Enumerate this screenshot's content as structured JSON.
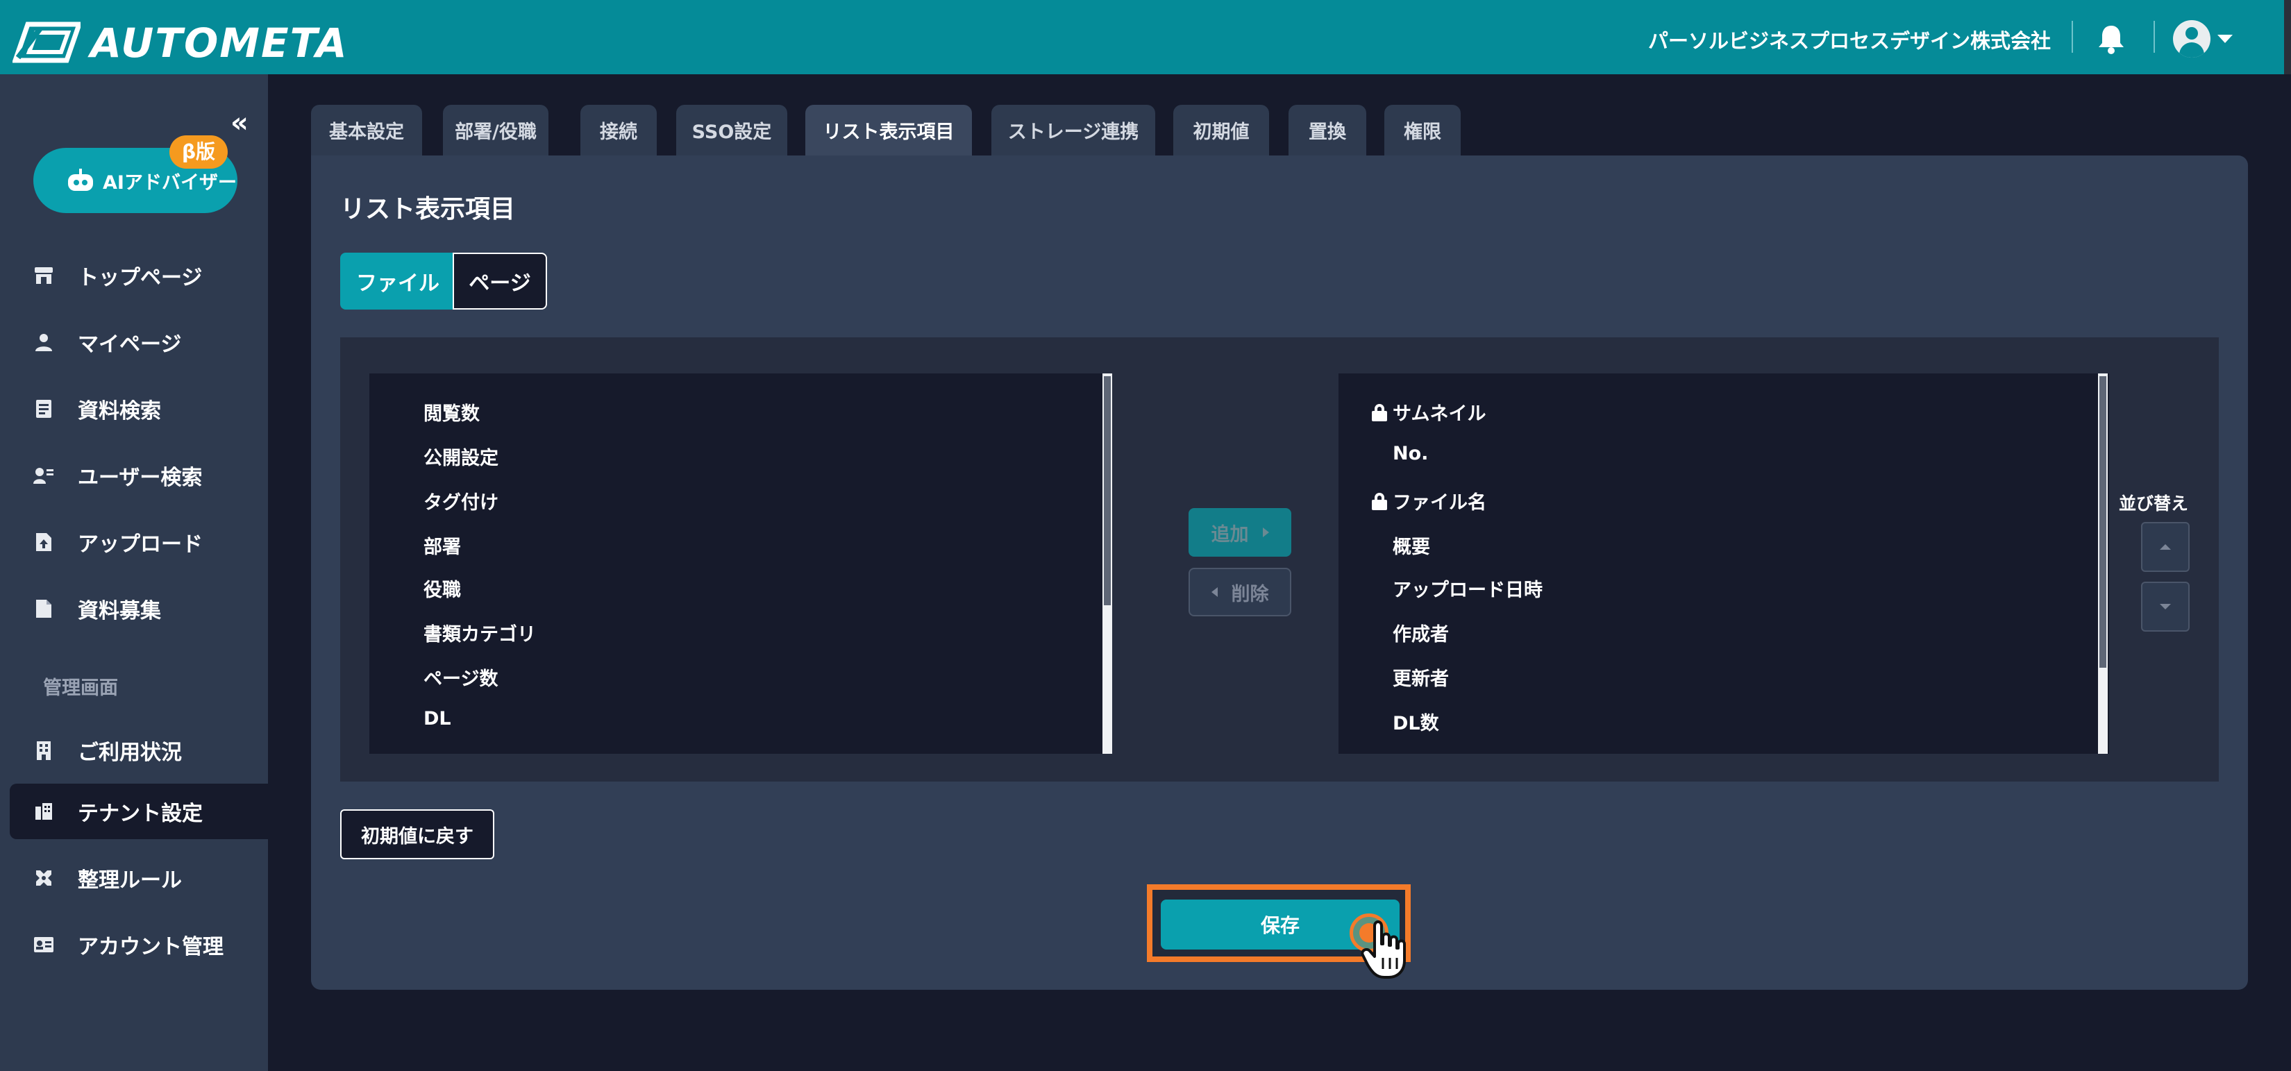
{
  "header": {
    "logo_text": "AUTOMETA",
    "company": "パーソルビジネスプロセスデザイン株式会社",
    "brand_color": "#058b98"
  },
  "sidebar": {
    "collapse_icon": "«",
    "ai_button": {
      "label": "AIアドバイザー",
      "badge": "β版"
    },
    "items": [
      {
        "label": "トップページ",
        "icon": "store-icon"
      },
      {
        "label": "マイページ",
        "icon": "person-icon"
      },
      {
        "label": "資料検索",
        "icon": "document-search-icon"
      },
      {
        "label": "ユーザー検索",
        "icon": "user-search-icon"
      },
      {
        "label": "アップロード",
        "icon": "file-upload-icon"
      },
      {
        "label": "資料募集",
        "icon": "file-icon"
      }
    ],
    "admin_section_title": "管理画面",
    "admin_items": [
      {
        "label": "ご利用状況",
        "icon": "building-icon"
      },
      {
        "label": "テナント設定",
        "icon": "tenant-icon",
        "active": true
      },
      {
        "label": "整理ルール",
        "icon": "tools-icon"
      },
      {
        "label": "アカウント管理",
        "icon": "id-card-icon"
      }
    ]
  },
  "tabs": [
    {
      "label": "基本設定"
    },
    {
      "label": "部署/役職"
    },
    {
      "label": "接続"
    },
    {
      "label": "SSO設定"
    },
    {
      "label": "リスト表示項目",
      "active": true
    },
    {
      "label": "ストレージ連携"
    },
    {
      "label": "初期値"
    },
    {
      "label": "置換"
    },
    {
      "label": "権限"
    }
  ],
  "panel": {
    "title": "リスト表示項目",
    "segment": {
      "file": "ファイル",
      "page": "ページ",
      "selected": "ファイル"
    },
    "available_items": [
      "閲覧数",
      "公開設定",
      "タグ付け",
      "部署",
      "役職",
      "書類カテゴリ",
      "ページ数",
      "DL"
    ],
    "selected_items": [
      {
        "label": "サムネイル",
        "locked": true
      },
      {
        "label": "No.",
        "locked": false
      },
      {
        "label": "ファイル名",
        "locked": true
      },
      {
        "label": "概要",
        "locked": false
      },
      {
        "label": "アップロード日時",
        "locked": false
      },
      {
        "label": "作成者",
        "locked": false
      },
      {
        "label": "更新者",
        "locked": false
      },
      {
        "label": "DL数",
        "locked": false
      }
    ],
    "add_label": "追加",
    "remove_label": "削除",
    "sort_label": "並び替え",
    "reset_label": "初期値に戻す",
    "save_label": "保存"
  }
}
